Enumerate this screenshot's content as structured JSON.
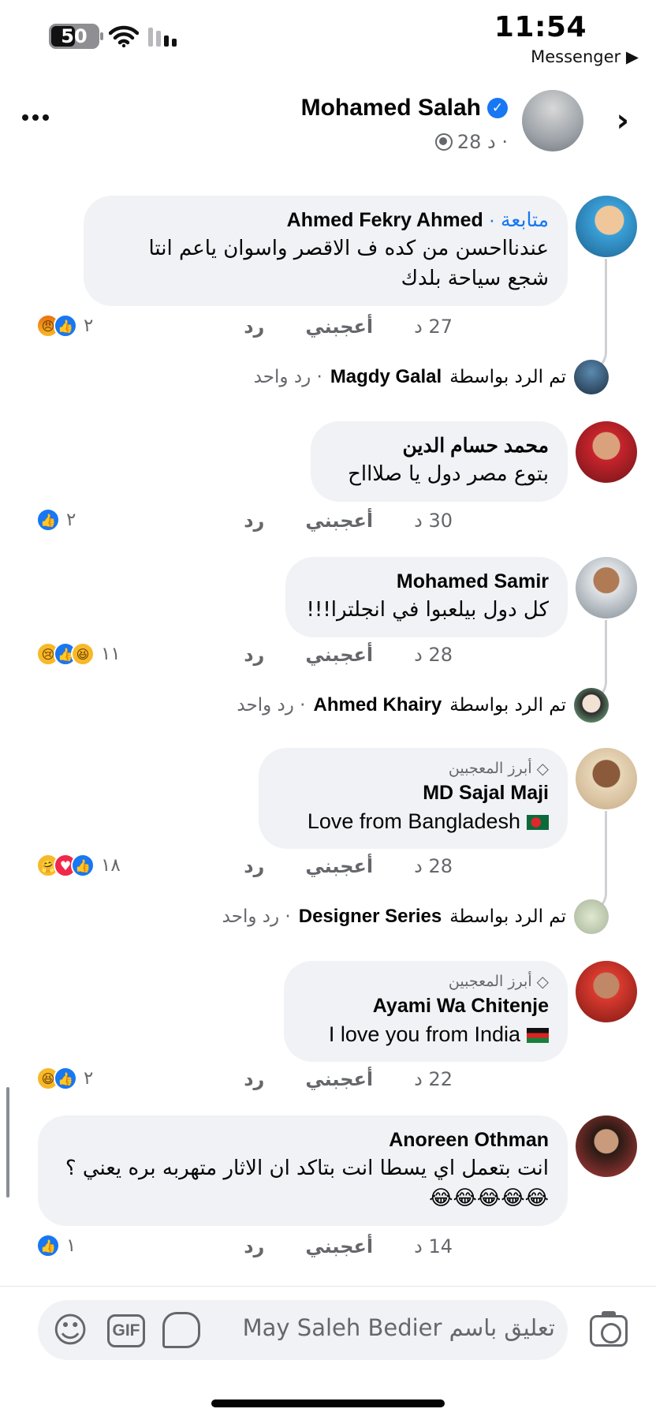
{
  "status_bar": {
    "battery": "50",
    "time": "11:54",
    "back_app": "Messenger ▶"
  },
  "post_header": {
    "author": "Mohamed Salah",
    "time": "28 د ·",
    "more_icon": "more-horizontal-icon",
    "next_icon": "chevron-right-icon"
  },
  "comments": [
    {
      "author": "Ahmed Fekry Ahmed",
      "follow_label": "متابعة",
      "text": "عندنااحسن من كده ف الاقصر واسوان ياعم انتا شجع سياحة بلدك",
      "time": "27 د",
      "like_label": "أعجبني",
      "reply_label": "رد",
      "reaction_count": "٢",
      "reactions": [
        "like",
        "angry"
      ],
      "replied": {
        "prefix": "تم الرد بواسطة",
        "name": "Magdy Galal",
        "suffix": "· رد واحد"
      }
    },
    {
      "author": "محمد حسام الدين",
      "text": "بتوع مصر دول يا صلاااح",
      "time": "30 د",
      "like_label": "أعجبني",
      "reply_label": "رد",
      "reaction_count": "٢",
      "reactions": [
        "like"
      ]
    },
    {
      "author": "Mohamed Samir",
      "text": "كل دول بيلعبوا في انجلترا!!!",
      "time": "28 د",
      "like_label": "أعجبني",
      "reply_label": "رد",
      "reaction_count": "١١",
      "reactions": [
        "haha",
        "like",
        "sad"
      ],
      "replied": {
        "prefix": "تم الرد بواسطة",
        "name": "Ahmed Khairy",
        "suffix": "· رد واحد"
      }
    },
    {
      "badge": "أبرز المعجبين",
      "author": "MD Sajal Maji",
      "text": "Love from Bangladesh",
      "time": "28 د",
      "like_label": "أعجبني",
      "reply_label": "رد",
      "reaction_count": "١٨",
      "reactions": [
        "like",
        "love",
        "care"
      ],
      "replied": {
        "prefix": "تم الرد بواسطة",
        "name": "Designer Series",
        "suffix": "· رد واحد"
      }
    },
    {
      "badge": "أبرز المعجبين",
      "author": "Ayami Wa Chitenje",
      "text": "I love you from India",
      "time": "22 د",
      "like_label": "أعجبني",
      "reply_label": "رد",
      "reaction_count": "٢",
      "reactions": [
        "like",
        "haha"
      ]
    },
    {
      "author": "Anoreen Othman",
      "text": "انت بتعمل اي يسطا انت بتاكد ان الاثار متهربه بره يعني ؟",
      "text_emoji": "😂😂😂😂😂",
      "time": "14 د",
      "like_label": "أعجبني",
      "reply_label": "رد",
      "reaction_count": "١",
      "reactions": [
        "like"
      ]
    }
  ],
  "composer": {
    "placeholder": "تعليق باسم May Saleh Bedier",
    "gif_label": "GIF",
    "emoji_icon": "smiley-icon",
    "sticker_icon": "sticker-icon",
    "camera_icon": "camera-icon"
  },
  "colors": {
    "accent": "#1877f2",
    "bubble": "#f0f2f5",
    "secondary_text": "#65676b"
  }
}
